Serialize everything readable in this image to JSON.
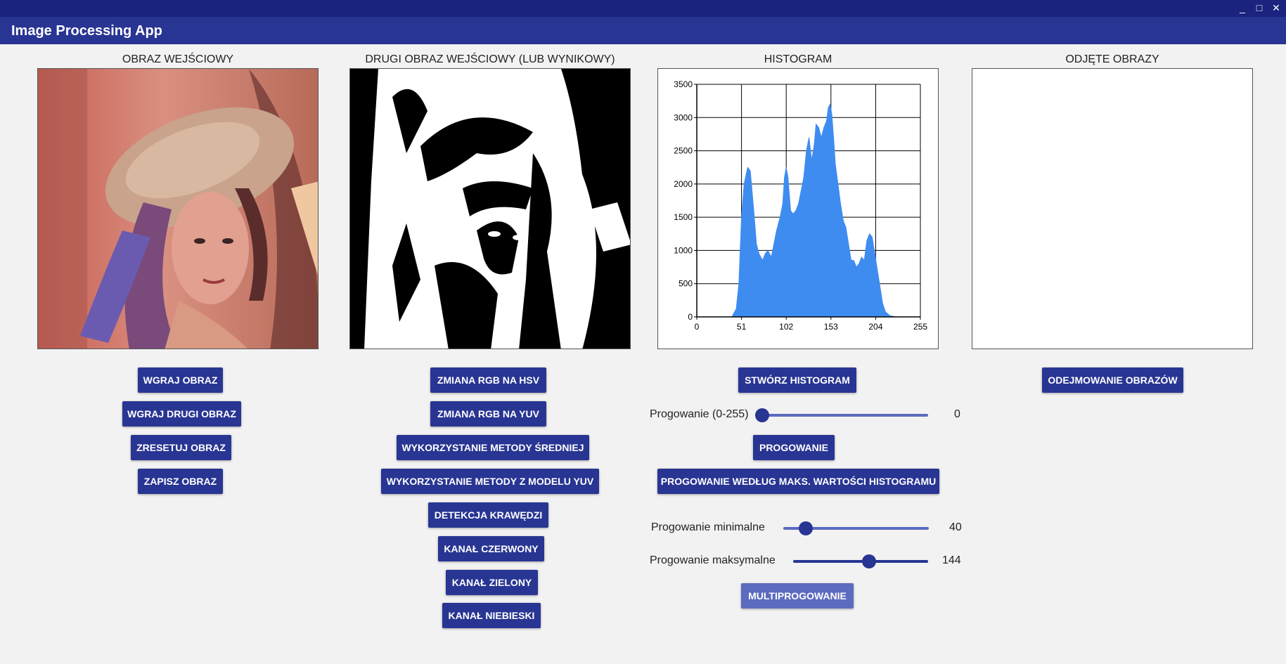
{
  "window": {
    "title": "Image Processing App",
    "controls": [
      "_",
      "□",
      "✕"
    ]
  },
  "panels": {
    "input": {
      "caption": "OBRAZ WEJŚCIOWY"
    },
    "second": {
      "caption": "DRUGI OBRAZ WEJŚCIOWY (LUB WYNIKOWY)"
    },
    "histogram": {
      "caption": "HISTOGRAM"
    },
    "subtracted": {
      "caption": "ODJĘTE OBRAZY"
    }
  },
  "buttons": {
    "load_image": "WGRAJ OBRAZ",
    "load_second_image": "WGRAJ DRUGI OBRAZ",
    "reset_image": "ZRESETUJ OBRAZ",
    "save_image": "ZAPISZ OBRAZ",
    "rgb_to_hsv": "ZMIANA RGB NA HSV",
    "rgb_to_yuv": "ZMIANA RGB NA YUV",
    "mean_method": "WYKORZYSTANIE METODY ŚREDNIEJ",
    "yuv_method": "WYKORZYSTANIE METODY Z MODELU YUV",
    "edge_detection": "DETEKCJA KRAWĘDZI",
    "red_channel": "KANAŁ CZERWONY",
    "green_channel": "KANAŁ ZIELONY",
    "blue_channel": "KANAŁ NIEBIESKI",
    "create_histogram": "STWÓRZ HISTOGRAM",
    "thresholding": "PROGOWANIE",
    "threshold_by_max": "PROGOWANIE WEDŁUG MAKS. WARTOŚCI HISTOGRAMU",
    "multithreshold": "MULTIPROGOWANIE",
    "subtract_images": "ODEJMOWANIE OBRAZÓW"
  },
  "sliders": {
    "threshold": {
      "label": "Progowanie (0-255)",
      "value": "0",
      "fraction": 0.0
    },
    "min": {
      "label": "Progowanie minimalne",
      "value": "40",
      "fraction": 0.157
    },
    "max": {
      "label": "Progowanie maksymalne",
      "value": "144",
      "fraction": 0.565
    }
  },
  "colors": {
    "title_bar": "#1a237e",
    "app_bar": "#283593",
    "button": "#283593",
    "slider": "#5c6bc0",
    "histogram_fill": "#3f8cf0"
  },
  "chart_data": {
    "type": "area",
    "xlim": [
      0,
      255
    ],
    "ylim": [
      0,
      3500
    ],
    "xticks": [
      "0",
      "51",
      "102",
      "153",
      "204",
      "255"
    ],
    "yticks": [
      "0",
      "500",
      "1000",
      "1500",
      "2000",
      "2500",
      "3000",
      "3500"
    ],
    "grid": true,
    "series": [
      {
        "x": [
          40,
          45,
          48,
          51,
          54,
          58,
          61,
          65,
          68,
          71,
          75,
          78,
          81,
          85,
          88,
          91,
          95,
          98,
          100,
          102,
          104,
          107,
          110,
          113,
          116,
          119,
          122,
          125,
          128,
          131,
          134,
          136,
          139,
          142,
          145,
          148,
          150,
          152,
          154,
          156,
          158,
          161,
          164,
          167,
          170,
          173,
          176,
          179,
          182,
          185,
          188,
          191,
          194,
          197,
          200,
          203,
          206,
          209,
          212,
          215,
          220,
          225,
          230
        ],
        "y": [
          0,
          120,
          500,
          1500,
          2000,
          2250,
          2200,
          1600,
          1100,
          950,
          850,
          950,
          1000,
          900,
          1100,
          1300,
          1500,
          1700,
          2100,
          2250,
          2100,
          1600,
          1550,
          1600,
          1700,
          1900,
          2100,
          2500,
          2700,
          2350,
          2600,
          2900,
          2850,
          2700,
          2850,
          2950,
          3150,
          3200,
          3050,
          2700,
          2300,
          2000,
          1700,
          1450,
          1350,
          1100,
          850,
          850,
          750,
          800,
          900,
          850,
          1150,
          1250,
          1200,
          950,
          700,
          450,
          200,
          80,
          20,
          5,
          0
        ]
      }
    ]
  }
}
